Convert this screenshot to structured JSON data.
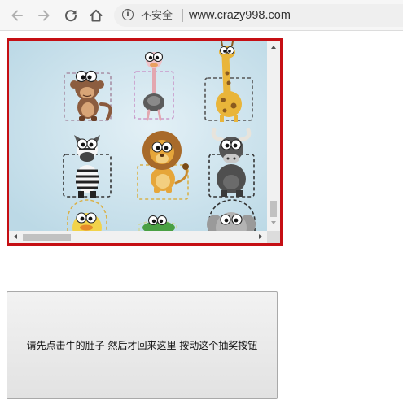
{
  "browser": {
    "security_label": "不安全",
    "url": "www.crazy998.com",
    "icons": {
      "back": "back-arrow-icon",
      "forward": "forward-arrow-icon",
      "reload": "reload-icon",
      "home": "home-icon",
      "info": "info-icon"
    }
  },
  "frame": {
    "border_color": "#c50f14",
    "background_color": "#c9e1eb",
    "animals": [
      "monkey",
      "ostrich",
      "giraffe",
      "zebra",
      "lion",
      "buffalo",
      "duck",
      "crocodile",
      "elephant"
    ]
  },
  "lottery": {
    "button_label": "请先点击牛的肚子 然后才回来这里 按动这个抽奖按钮"
  }
}
